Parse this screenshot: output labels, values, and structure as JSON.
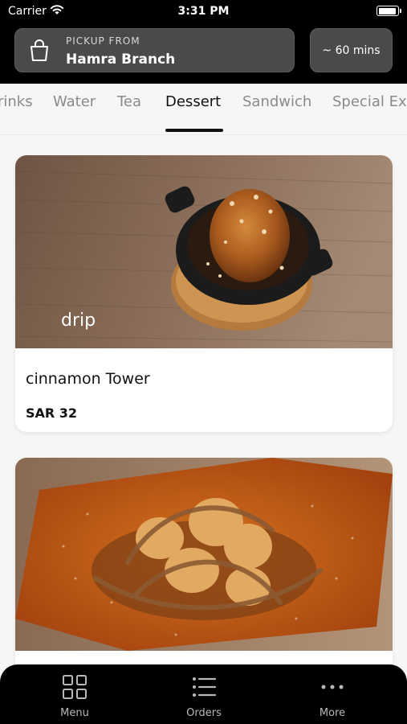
{
  "status_bar": {
    "carrier": "Carrier",
    "time": "3:31 PM"
  },
  "pickup": {
    "kicker": "PICKUP FROM",
    "branch": "Hamra Branch"
  },
  "eta": "~ 60 mins",
  "categories": [
    "rinks",
    "Water",
    "Tea",
    "Dessert",
    "Sandwich",
    "Special Ext"
  ],
  "active_category": "Dessert",
  "items": [
    {
      "name": "cinnamon Tower",
      "price": "SAR 32",
      "photo_logo": "drip"
    },
    {
      "name": "",
      "price": ""
    }
  ],
  "bottom_nav": [
    {
      "label": "Menu",
      "icon": "grid-icon"
    },
    {
      "label": "Orders",
      "icon": "list-icon"
    },
    {
      "label": "More",
      "icon": "more-dots-icon"
    }
  ]
}
